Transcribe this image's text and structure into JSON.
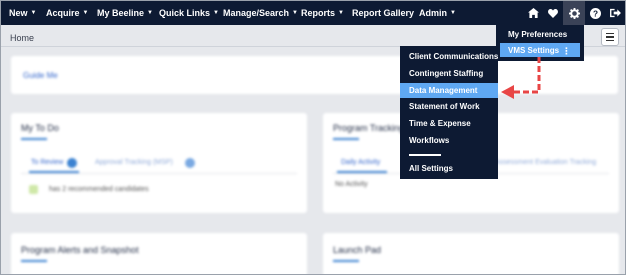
{
  "nav": {
    "items": [
      {
        "label": "New"
      },
      {
        "label": "Acquire"
      },
      {
        "label": "My Beeline"
      },
      {
        "label": "Quick Links"
      },
      {
        "label": "Manage/Search"
      },
      {
        "label": "Reports"
      },
      {
        "label": "Report Gallery"
      },
      {
        "label": "Admin"
      }
    ],
    "caret": "▼"
  },
  "icons": [
    "home-icon",
    "heart-icon",
    "gear-icon",
    "help-icon",
    "logout-icon"
  ],
  "breadcrumb": "Home",
  "settings_menu": {
    "my_preferences": "My Preferences",
    "vms_settings": "VMS Settings",
    "kebab": "⋮"
  },
  "submenu": {
    "items": [
      {
        "label": "Client Communications"
      },
      {
        "label": "Contingent Staffing"
      },
      {
        "label": "Data Management"
      },
      {
        "label": "Statement of Work"
      },
      {
        "label": "Time & Expense"
      },
      {
        "label": "Workflows"
      }
    ],
    "all_settings": "All Settings",
    "highlighted": "Data Management"
  },
  "background": {
    "guide_link": "Guide Me",
    "my_todo": {
      "title": "My To Do",
      "tab1": "To Review",
      "tab2": "Approval Tracking (MSP)",
      "row_text": "has 2 recommended candidates"
    },
    "program_tracking": {
      "title": "Program Tracking",
      "tab1": "Daily Activity",
      "tab2": "Assessment Evaluation Tracking",
      "row_text": "No Activity"
    },
    "alerts_title": "Program Alerts and Snapshot",
    "launch_pad_title": "Launch Pad"
  },
  "colors": {
    "nav_bg": "#0d1a33",
    "highlight": "#5fa8f2",
    "accent_blue": "#3b82d1",
    "arrow_red": "#e84545"
  }
}
